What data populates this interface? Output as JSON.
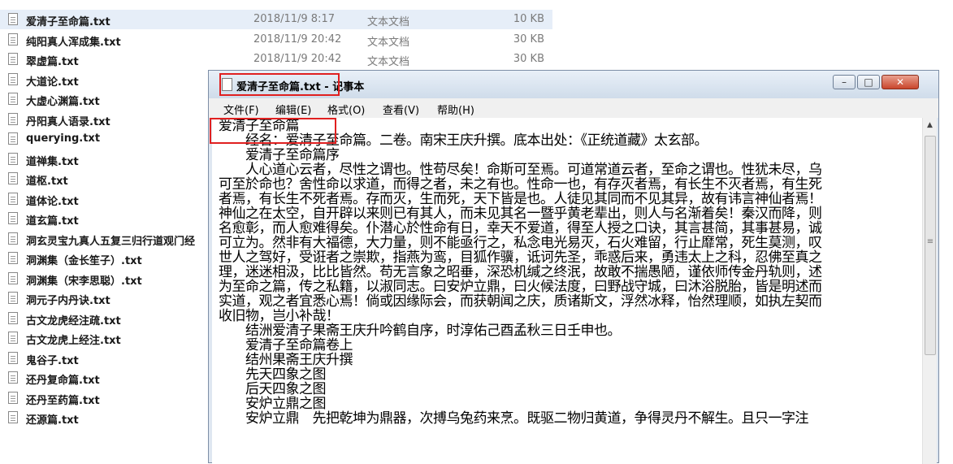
{
  "files": [
    {
      "name": "爱清子至命篇.txt",
      "date": "2018/11/9 8:17",
      "type": "文本文档",
      "size": "10 KB",
      "selected": true
    },
    {
      "name": "纯阳真人浑成集.txt",
      "date": "2018/11/9 20:42",
      "type": "文本文档",
      "size": "30 KB"
    },
    {
      "name": "翠虚篇.txt",
      "date": "2018/11/9 20:42",
      "type": "文本文档",
      "size": "30 KB"
    },
    {
      "name": "大道论.txt"
    },
    {
      "name": "大虚心渊篇.txt"
    },
    {
      "name": "丹阳真人语录.txt"
    },
    {
      "name": "querying.txt"
    },
    {
      "name": "道禅集.txt"
    },
    {
      "name": "道枢.txt"
    },
    {
      "name": "道体论.txt"
    },
    {
      "name": "道玄篇.txt"
    },
    {
      "name": "洞玄灵宝九真人五复三归行道观门经"
    },
    {
      "name": "洞渊集（金长笙子）.txt"
    },
    {
      "name": "洞渊集（宋李思聪）.txt"
    },
    {
      "name": "洞元子内丹诀.txt"
    },
    {
      "name": "古文龙虎经注疏.txt"
    },
    {
      "name": "古文龙虎上经注.txt"
    },
    {
      "name": "鬼谷子.txt"
    },
    {
      "name": "还丹复命篇.txt"
    },
    {
      "name": "还丹至药篇.txt"
    },
    {
      "name": "还源篇.txt"
    }
  ],
  "notepad": {
    "title": "爱清子至命篇.txt - 记事本",
    "menu": [
      "文件(F)",
      "编辑(E)",
      "格式(O)",
      "查看(V)",
      "帮助(H)"
    ],
    "lines": [
      "爱清子至命篇",
      "　　经名：爱清子至命篇。二卷。南宋王庆升撰。底本出处：《正统道藏》太玄部。",
      "　　爱清子至命篇序",
      "　　人心道心云者，尽性之谓也。性苟尽矣！命斯可至焉。可道常道云者，至命之谓也。性犹未尽，乌",
      "可至於命也？舍性命以求道，而得之者，未之有也。性命一也，有存灭者焉，有长生不灭者焉，有生死",
      "者焉，有长生不死者焉。存而灭，生而死，天下皆是也。人徒见其同而不见其异，故有讳言神仙者焉！",
      "神仙之在太空，自开辟以来则已有其人，而未见其名一暨乎黄老辈出，则人与名渐着矣！秦汉而降，则",
      "名愈彰，而人愈难得矣。仆潜心於性命有日，幸天不爱道，得至人授之口诀，其言甚简，其事甚易，诚",
      "可立为。然非有大福德，大力量，则不能亟行之，私念电光易灭，石火难留，行止靡常，死生莫测，叹",
      "世人之驾好，受诳者之崇欺，指燕为鸾，目狐作骥，诋诃先圣，乖惑后来，勇违太上之科，忍佛至真之",
      "理，迷迷相汲，比比皆然。苟无言象之昭垂，深恐机缄之终泯，故敢不揣愚陋，谨依师传金丹轨则，述",
      "为至命之篇，传之私籍，以淑同志。曰安炉立鼎，曰火候法度，曰野战守城，曰沐浴脱胎，皆是明述而",
      "实道，观之者宜悉心焉！倘或因缘际会，而获朝闻之庆，质诸斯文，浮然冰释，怡然理顺，如执左契而",
      "收旧物，岂小补哉！",
      "　　结洲爱清子果斋王庆升吟鹤自序，时淳佑己酉孟秋三日壬申也。",
      "　　爱清子至命篇卷上",
      "　　结州果斋王庆升撰",
      "　　先天四象之图",
      "　　后天四象之图",
      "　　安炉立鼎之图",
      "　　安炉立鼎　先把乾坤为鼎器，次搏乌兔药来烹。既驱二物归黄道，争得灵丹不解生。且只一字注"
    ]
  }
}
